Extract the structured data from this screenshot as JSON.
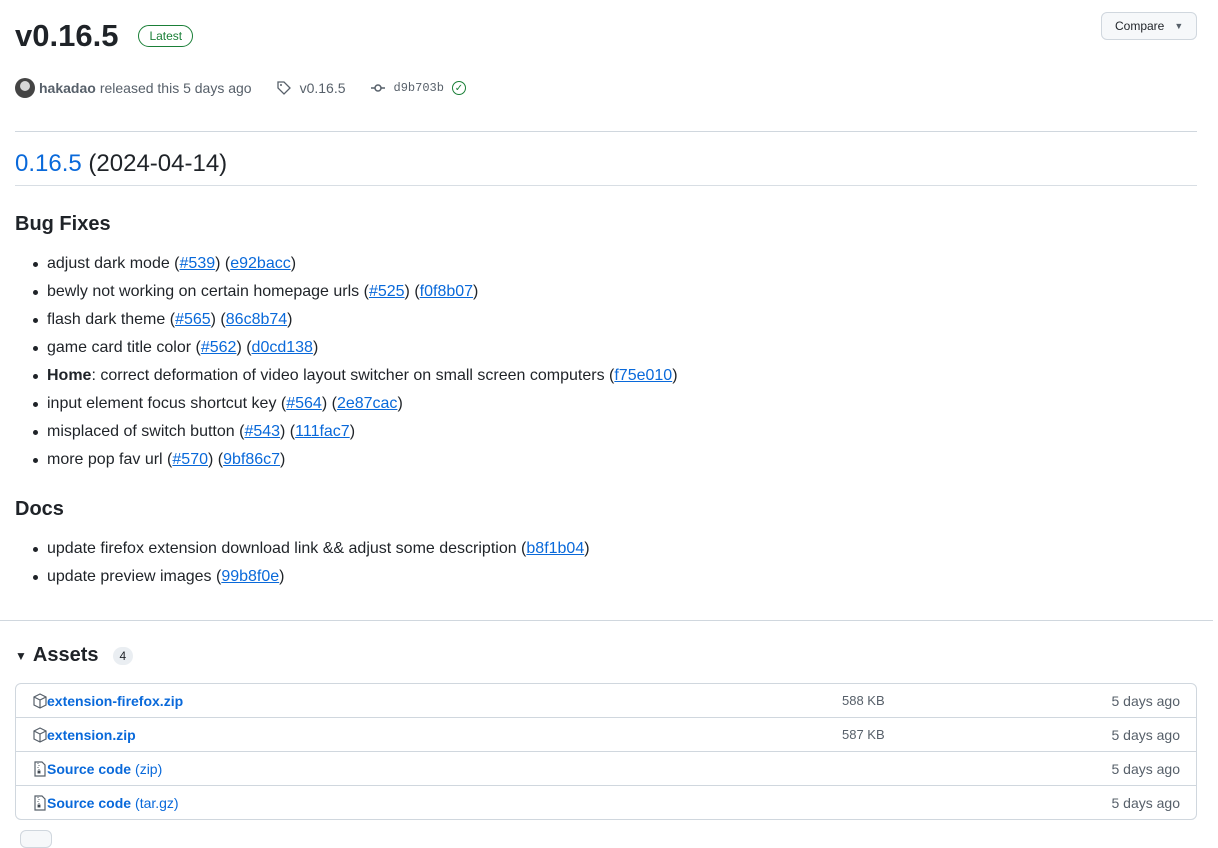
{
  "release": {
    "title": "v0.16.5",
    "badge": "Latest",
    "compare_label": "Compare",
    "author": "hakadao",
    "released_text": "released this 5 days ago",
    "tag": "v0.16.5",
    "commit": "d9b703b"
  },
  "notes": {
    "version_link": "0.16.5",
    "version_date": "(2024-04-14)",
    "sections": [
      {
        "heading": "Bug Fixes",
        "items": [
          {
            "text": "adjust dark mode",
            "pr": "#539",
            "commit": "e92bacc"
          },
          {
            "text": "bewly not working on certain homepage urls",
            "pr": "#525",
            "commit": "f0f8b07"
          },
          {
            "text": "flash dark theme",
            "pr": "#565",
            "commit": "86c8b74"
          },
          {
            "text": "game card title color",
            "pr": "#562",
            "commit": "d0cd138"
          },
          {
            "bold": "Home",
            "text": ": correct deformation of video layout switcher on small screen computers",
            "commit": "f75e010"
          },
          {
            "text": "input element focus shortcut key",
            "pr": "#564",
            "commit": "2e87cac"
          },
          {
            "text": "misplaced of switch button",
            "pr": "#543",
            "commit": "111fac7"
          },
          {
            "text": "more pop fav url",
            "pr": "#570",
            "commit": "9bf86c7"
          }
        ]
      },
      {
        "heading": "Docs",
        "items": [
          {
            "text": "update firefox extension download link && adjust some description",
            "commit": "b8f1b04"
          },
          {
            "text": "update preview images",
            "commit": "99b8f0e"
          }
        ]
      }
    ]
  },
  "assets": {
    "heading": "Assets",
    "count": "4",
    "rows": [
      {
        "icon": "package-icon",
        "name": "extension-firefox.zip",
        "ext": "",
        "size": "588 KB",
        "date": "5 days ago"
      },
      {
        "icon": "package-icon",
        "name": "extension.zip",
        "ext": "",
        "size": "587 KB",
        "date": "5 days ago"
      },
      {
        "icon": "file-zip-icon",
        "name": "Source code",
        "ext": "(zip)",
        "size": "",
        "date": "5 days ago"
      },
      {
        "icon": "file-zip-icon",
        "name": "Source code",
        "ext": "(tar.gz)",
        "size": "",
        "date": "5 days ago"
      }
    ]
  }
}
